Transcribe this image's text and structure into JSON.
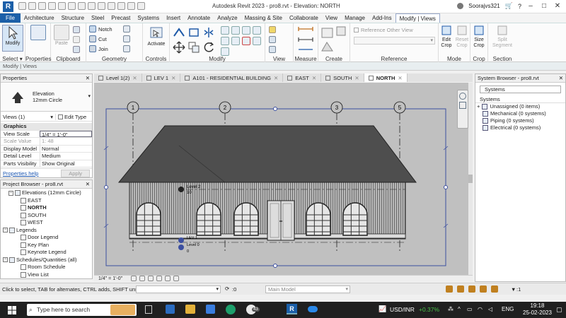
{
  "titlebar": {
    "title": "Autodesk Revit 2023 - pro8.rvt - Elevation: NORTH",
    "user": "Soorajvs321",
    "logo": "R"
  },
  "tabs": [
    "File",
    "Architecture",
    "Structure",
    "Steel",
    "Precast",
    "Systems",
    "Insert",
    "Annotate",
    "Analyze",
    "Massing & Site",
    "Collaborate",
    "View",
    "Manage",
    "Add-Ins",
    "Modify | Views"
  ],
  "active_tab": "Modify | Views",
  "ribbon": {
    "modify_label": "Modify",
    "paste_label": "Paste",
    "notch": "Notch",
    "cut": "Cut",
    "join": "Join",
    "activate": "Activate",
    "reference_other_view": "Reference Other View",
    "edit_crop": "Edit\nCrop",
    "reset_crop": "Reset\nCrop",
    "size_crop": "Size\nCrop",
    "split_segment": "Split\nSegment",
    "panels": {
      "select": "Select ▾",
      "properties": "Properties",
      "clipboard": "Clipboard",
      "geometry": "Geometry",
      "controls": "Controls",
      "modify": "Modify",
      "view": "View",
      "measure": "Measure",
      "create": "Create",
      "reference": "Reference",
      "mode": "Mode",
      "crop": "Crop",
      "section": "Section"
    }
  },
  "options_bar": "Modify | Views",
  "properties": {
    "header": "Properties",
    "type_name": "Elevation",
    "type_sub": "12mm Circle",
    "views_selector": "Views (1)",
    "edit_type": "Edit Type",
    "group": "Graphics",
    "rows": [
      {
        "k": "View Scale",
        "v": "1/4\" = 1'-0\""
      },
      {
        "k": "Scale Value",
        "v": "1:   48"
      },
      {
        "k": "Display Model",
        "v": "Normal"
      },
      {
        "k": "Detail Level",
        "v": "Medium"
      },
      {
        "k": "Parts Visibility",
        "v": "Show Original"
      }
    ],
    "help": "Properties help",
    "apply": "Apply"
  },
  "project_browser": {
    "header": "Project Browser - pro8.rvt",
    "items": [
      {
        "label": "Elevations (12mm Circle)",
        "level": 1,
        "kind": "group"
      },
      {
        "label": "EAST",
        "level": 2,
        "kind": "view"
      },
      {
        "label": "NORTH",
        "level": 2,
        "kind": "view",
        "bold": true
      },
      {
        "label": "SOUTH",
        "level": 2,
        "kind": "view"
      },
      {
        "label": "WEST",
        "level": 2,
        "kind": "view"
      },
      {
        "label": "Legends",
        "level": 0,
        "kind": "group"
      },
      {
        "label": "Door Legend",
        "level": 2,
        "kind": "view"
      },
      {
        "label": "Key Plan",
        "level": 2,
        "kind": "view"
      },
      {
        "label": "Keynote Legend",
        "level": 2,
        "kind": "view"
      },
      {
        "label": "Schedules/Quantities (all)",
        "level": 0,
        "kind": "group"
      },
      {
        "label": "Room Schedule",
        "level": 2,
        "kind": "view"
      },
      {
        "label": "View List",
        "level": 2,
        "kind": "view"
      }
    ]
  },
  "view_tabs": [
    {
      "label": "Level 1(2)",
      "active": false
    },
    {
      "label": "LEV 1",
      "active": false
    },
    {
      "label": "A101 - RESIDENTIAL BUILDING",
      "active": false
    },
    {
      "label": "EAST",
      "active": false
    },
    {
      "label": "SOUTH",
      "active": false
    },
    {
      "label": "NORTH",
      "active": true
    }
  ],
  "canvas": {
    "grids": [
      "1",
      "2",
      "3",
      "5"
    ],
    "level2_name": "Level 2",
    "level2_elev": "10",
    "lev1_name": "LEV 1",
    "level0_name": "Level 0",
    "level0_elev": "0",
    "view_scale": "1/4\" = 1'-0\""
  },
  "system_browser": {
    "header": "System Browser - pro8.rvt",
    "dropdown": "Systems",
    "column": "Systems",
    "items": [
      "Unassigned (0 items)",
      "Mechanical (0 systems)",
      "Piping (0 systems)",
      "Electrical (0 systems)"
    ]
  },
  "status_bar": {
    "hint": "Click to select, TAB for alternates, CTRL adds, SHIFT unse",
    "counter": ":0",
    "model": "Main Model",
    "filter": ":1"
  },
  "taskbar": {
    "search": "Type here to search",
    "ticker": "USD/INR",
    "change": "+0.37%",
    "lang": "ENG",
    "time": "19:18",
    "date": "25-02-2023",
    "badge": "43"
  },
  "colors": {
    "revit_blue": "#1b5fa8",
    "canvas_bg": "#c0c0c0",
    "crop_blue": "#3c4fa0",
    "roof": "#505050",
    "taskbar": "#202020",
    "positive": "#47c147"
  }
}
